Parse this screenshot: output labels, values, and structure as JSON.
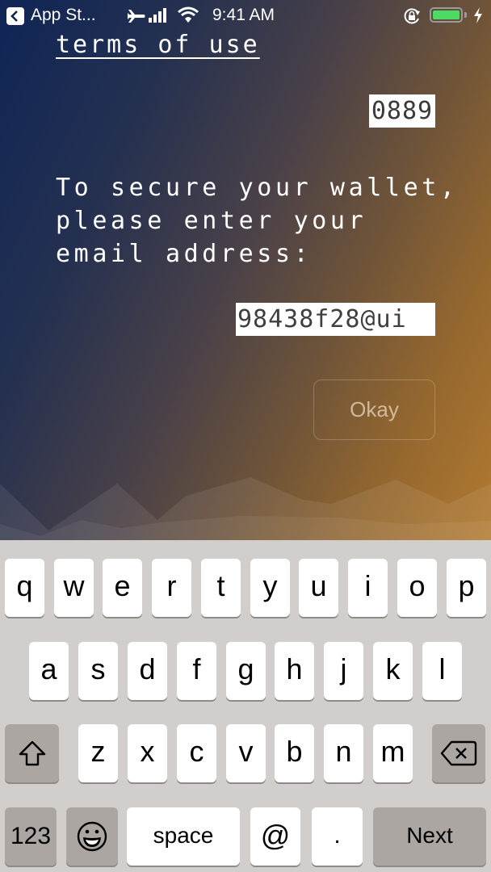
{
  "status_bar": {
    "back_app": "App St...",
    "time": "9:41 AM",
    "icons": [
      "back-arrow-icon",
      "airplane-icon",
      "signal-icon",
      "wifi-icon",
      "orientation-lock-icon",
      "battery-icon",
      "charging-bolt-icon"
    ],
    "battery_percent": 100,
    "battery_color": "#4cd964"
  },
  "content": {
    "terms_link": "terms of use",
    "code_value": "0889",
    "prompt_lines": [
      "To secure your wallet,",
      "please enter your",
      "email address:"
    ],
    "email_value": "98438f28@ui",
    "okay_label": "Okay"
  },
  "keyboard": {
    "row1": [
      "q",
      "w",
      "e",
      "r",
      "t",
      "y",
      "u",
      "i",
      "o",
      "p"
    ],
    "row2": [
      "a",
      "s",
      "d",
      "f",
      "g",
      "h",
      "j",
      "k",
      "l"
    ],
    "row3": [
      "z",
      "x",
      "c",
      "v",
      "b",
      "n",
      "m"
    ],
    "numbers_label": "123",
    "space_label": "space",
    "at_label": "@",
    "dot_label": ".",
    "next_label": "Next",
    "icons": [
      "shift-icon",
      "delete-icon",
      "emoji-icon"
    ]
  }
}
